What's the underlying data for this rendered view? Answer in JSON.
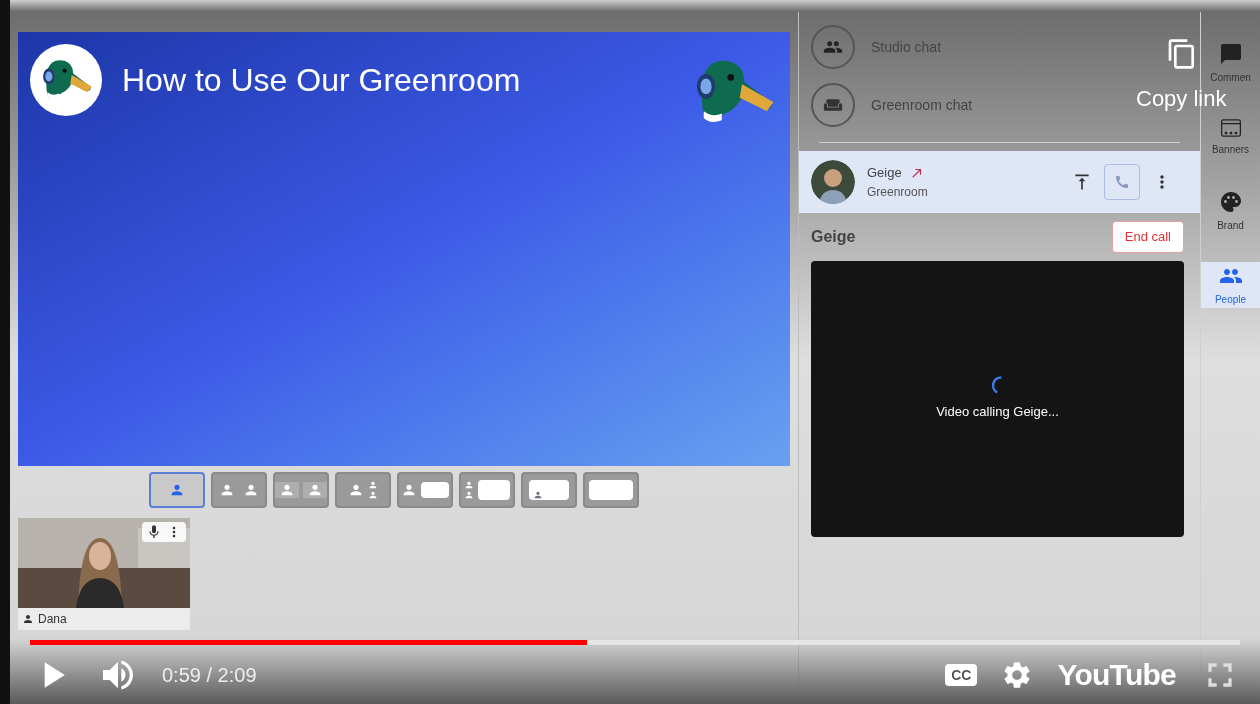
{
  "video": {
    "title": "How to Use Our Greenroom"
  },
  "layouts": [
    {
      "kind": "solo",
      "selected": true
    },
    {
      "kind": "split",
      "selected": false
    },
    {
      "kind": "pair",
      "selected": false
    },
    {
      "kind": "trio",
      "selected": false
    },
    {
      "kind": "person-screen",
      "selected": false
    },
    {
      "kind": "stack-screen",
      "selected": false
    },
    {
      "kind": "small-screen",
      "selected": false
    },
    {
      "kind": "screen",
      "selected": false
    }
  ],
  "participant_tile": {
    "name": "Dana"
  },
  "chats": [
    {
      "kind": "studio",
      "label": "Studio chat"
    },
    {
      "kind": "greenroom",
      "label": "Greenroom chat"
    }
  ],
  "guest": {
    "name": "Geige",
    "location": "Greenroom",
    "selected": true
  },
  "call": {
    "name": "Geige",
    "end_button": "End call",
    "status": "Video calling Geige..."
  },
  "rail": [
    {
      "kind": "comment",
      "label": "Commen",
      "selected": false
    },
    {
      "kind": "banners",
      "label": "Banners",
      "selected": false
    },
    {
      "kind": "brand",
      "label": "Brand",
      "selected": false
    },
    {
      "kind": "people",
      "label": "People",
      "selected": true
    }
  ],
  "player": {
    "copy_link": "Copy link",
    "time": "0:59 / 2:09",
    "level": 0.46,
    "captions": "CC",
    "logo": "YouTube"
  }
}
